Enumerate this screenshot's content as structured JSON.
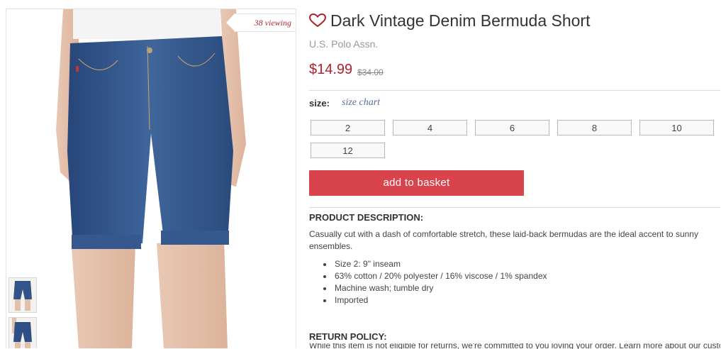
{
  "product": {
    "title": "Dark Vintage Denim Bermuda Short",
    "brand": "U.S. Polo Assn.",
    "price": "$14.99",
    "old_price": "$34.00",
    "viewing": "38 viewing"
  },
  "size": {
    "label": "size:",
    "chart_link": "size chart",
    "options": [
      "2",
      "4",
      "6",
      "8",
      "10",
      "12"
    ]
  },
  "cart": {
    "add_label": "add to basket"
  },
  "description": {
    "heading": "PRODUCT DESCRIPTION:",
    "text": "Casually cut with a dash of comfortable stretch, these laid-back bermudas are the ideal accent to sunny ensembles.",
    "bullets": [
      "Size 2: 9\" inseam",
      "63% cotton / 20% polyester / 16% viscose / 1% spandex",
      "Machine wash; tumble dry",
      "Imported"
    ]
  },
  "returns": {
    "heading": "RETURN POLICY:",
    "text": "While this item is not eligible for returns, we're committed to you loving your order. Learn more about our customer"
  },
  "colors": {
    "accent": "#d9434c",
    "price": "#b1212d",
    "link": "#5b6f9a",
    "denim": "#2c4e7f"
  }
}
